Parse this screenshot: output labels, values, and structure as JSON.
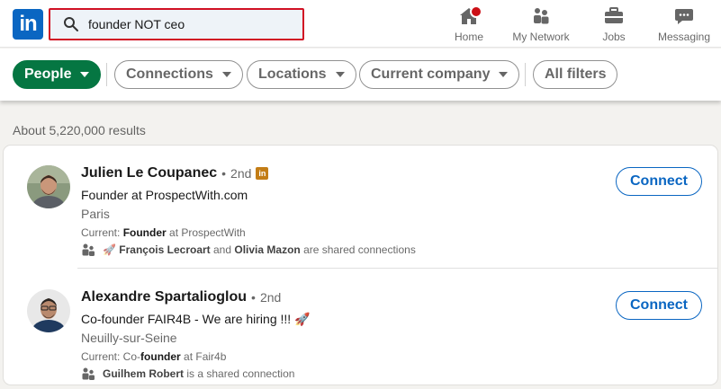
{
  "header": {
    "logo_text": "in",
    "search": {
      "value": "founder NOT ceo",
      "placeholder": "Search"
    },
    "nav": [
      {
        "label": "Home",
        "icon": "home-icon",
        "has_notification": true
      },
      {
        "label": "My Network",
        "icon": "network-icon"
      },
      {
        "label": "Jobs",
        "icon": "briefcase-icon"
      },
      {
        "label": "Messaging",
        "icon": "messaging-icon"
      }
    ]
  },
  "filters": {
    "people": "People",
    "connections": "Connections",
    "locations": "Locations",
    "current_company": "Current company",
    "all_filters": "All filters"
  },
  "results_count": "About 5,220,000 results",
  "results": [
    {
      "name": "Julien Le Coupanec",
      "separator": "•",
      "degree": "2nd",
      "badge": "in",
      "headline": "Founder at ProspectWith.com",
      "location": "Paris",
      "current_prefix": "Current: ",
      "current_bold": "Founder",
      "current_suffix": " at ProspectWith",
      "shared_emoji": "🚀",
      "shared_name_1": "François Lecroart",
      "shared_and": " and ",
      "shared_name_2": "Olivia Mazon",
      "shared_suffix": " are shared connections",
      "action": "Connect"
    },
    {
      "name": "Alexandre Spartalioglou",
      "separator": "•",
      "degree": "2nd",
      "headline": "Co-founder FAIR4B - We are hiring !!! 🚀",
      "location": "Neuilly-sur-Seine",
      "current_prefix": "Current: Co-",
      "current_bold": "founder",
      "current_suffix": " at Fair4b",
      "shared_name_1": "Guilhem Robert",
      "shared_suffix": " is a shared connection",
      "action": "Connect"
    }
  ],
  "colors": {
    "brand": "#0a66c2",
    "active_filter": "#057642",
    "search_highlight": "#d11124",
    "notification": "#cc1016"
  }
}
